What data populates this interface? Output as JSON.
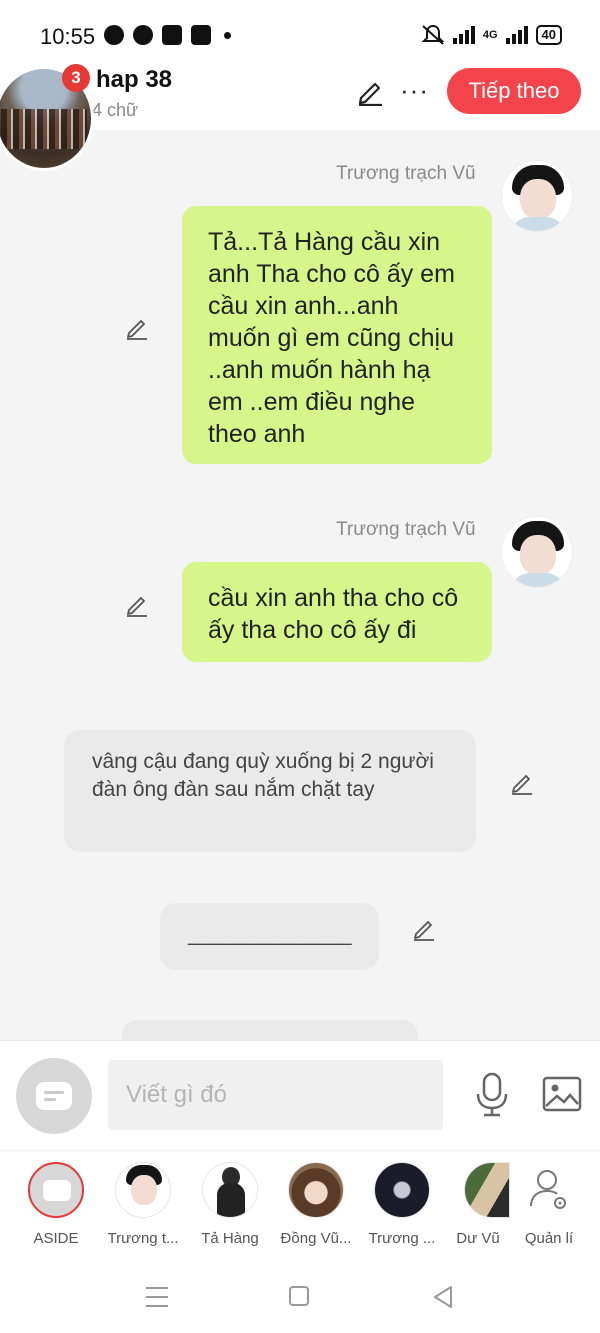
{
  "status_bar": {
    "time": "10:55",
    "network": "4G",
    "battery": "40",
    "icons": [
      "messenger-icon",
      "chat-icon",
      "star-app-icon",
      "shopee-icon",
      "dot-icon",
      "mute-icon",
      "signal-icon",
      "signal-icon",
      "battery-icon"
    ]
  },
  "header": {
    "title": "hap 38",
    "subtitle": "4 chữ",
    "notification_count": "3",
    "next_button": "Tiếp theo",
    "icons": [
      "edit-icon",
      "more-icon"
    ]
  },
  "messages": [
    {
      "speaker": "Trương trạch Vũ",
      "text": "Tả...Tả Hàng cầu xin anh Tha cho cô ấy em cầu xin anh...anh muốn gì em cũng chịu ..anh muốn hành hạ em ..em điều nghe theo anh"
    },
    {
      "speaker": "Trương trạch Vũ",
      "text": "cầu xin anh tha cho cô ấy tha cho cô ấy đi"
    },
    {
      "speaker": "",
      "text": "vâng cậu đang quỳ xuống bị 2 người đàn ông đàn sau nắm chặt tay"
    },
    {
      "speaker": "",
      "text": "______________"
    }
  ],
  "composer": {
    "placeholder": "Viết gì đó",
    "icons": [
      "aside-icon",
      "microphone-icon",
      "image-icon"
    ]
  },
  "characters": [
    {
      "label": "ASIDE"
    },
    {
      "label": "Trương t..."
    },
    {
      "label": "Tả Hàng"
    },
    {
      "label": "Đồng Vũ..."
    },
    {
      "label": "Trương ..."
    },
    {
      "label": "Dư Vũ"
    },
    {
      "label": "Quản lí"
    }
  ],
  "colors": {
    "accent": "#f2444a",
    "bubble_character": "#d6f58a",
    "bubble_narration": "#eaeaea",
    "badge": "#e53935"
  }
}
